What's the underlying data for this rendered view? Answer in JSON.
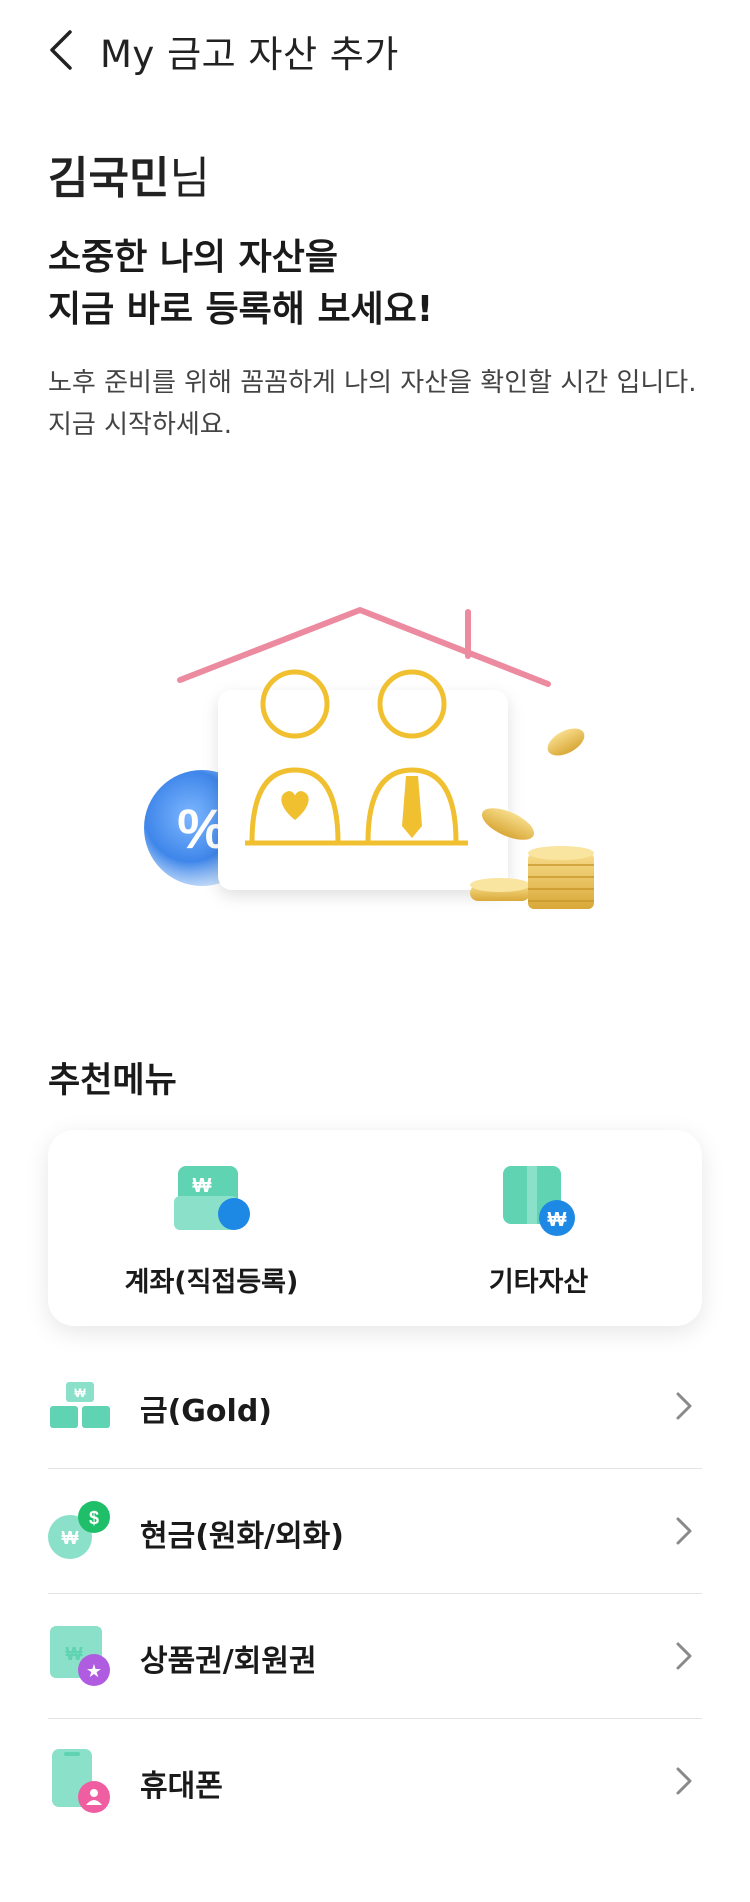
{
  "header": {
    "title": "My 금고 자산 추가",
    "back_icon": "chevron-left-icon"
  },
  "greeting": {
    "name": "김국민",
    "suffix": "님"
  },
  "headline": {
    "line1": "소중한 나의 자산을",
    "line2": "지금 바로 등록해 보세요!"
  },
  "description": {
    "line1": "노후 준비를 위해 꼼꼼하게 나의 자산을 확인할 시간 입니다.",
    "line2": "지금 시작하세요."
  },
  "hero": {
    "icons": [
      "house-icon",
      "couple-icon",
      "percent-icon",
      "coins-icon"
    ]
  },
  "recommended": {
    "title": "추천메뉴",
    "items": [
      {
        "label": "계좌(직접등록)",
        "icon": "account-icon"
      },
      {
        "label": "기타자산",
        "icon": "other-assets-icon"
      }
    ]
  },
  "assets": [
    {
      "label": "금(Gold)",
      "icon": "gold-bar-icon"
    },
    {
      "label": "현금(원화/외화)",
      "icon": "cash-icon"
    },
    {
      "label": "상품권/회원권",
      "icon": "voucher-icon"
    },
    {
      "label": "휴대폰",
      "icon": "phone-icon"
    }
  ],
  "colors": {
    "mint": "#5fd3b2",
    "blue": "#1e88e5",
    "gold": "#f0c030",
    "roof": "#ec8aa0",
    "chevron": "#8a8a8a"
  }
}
